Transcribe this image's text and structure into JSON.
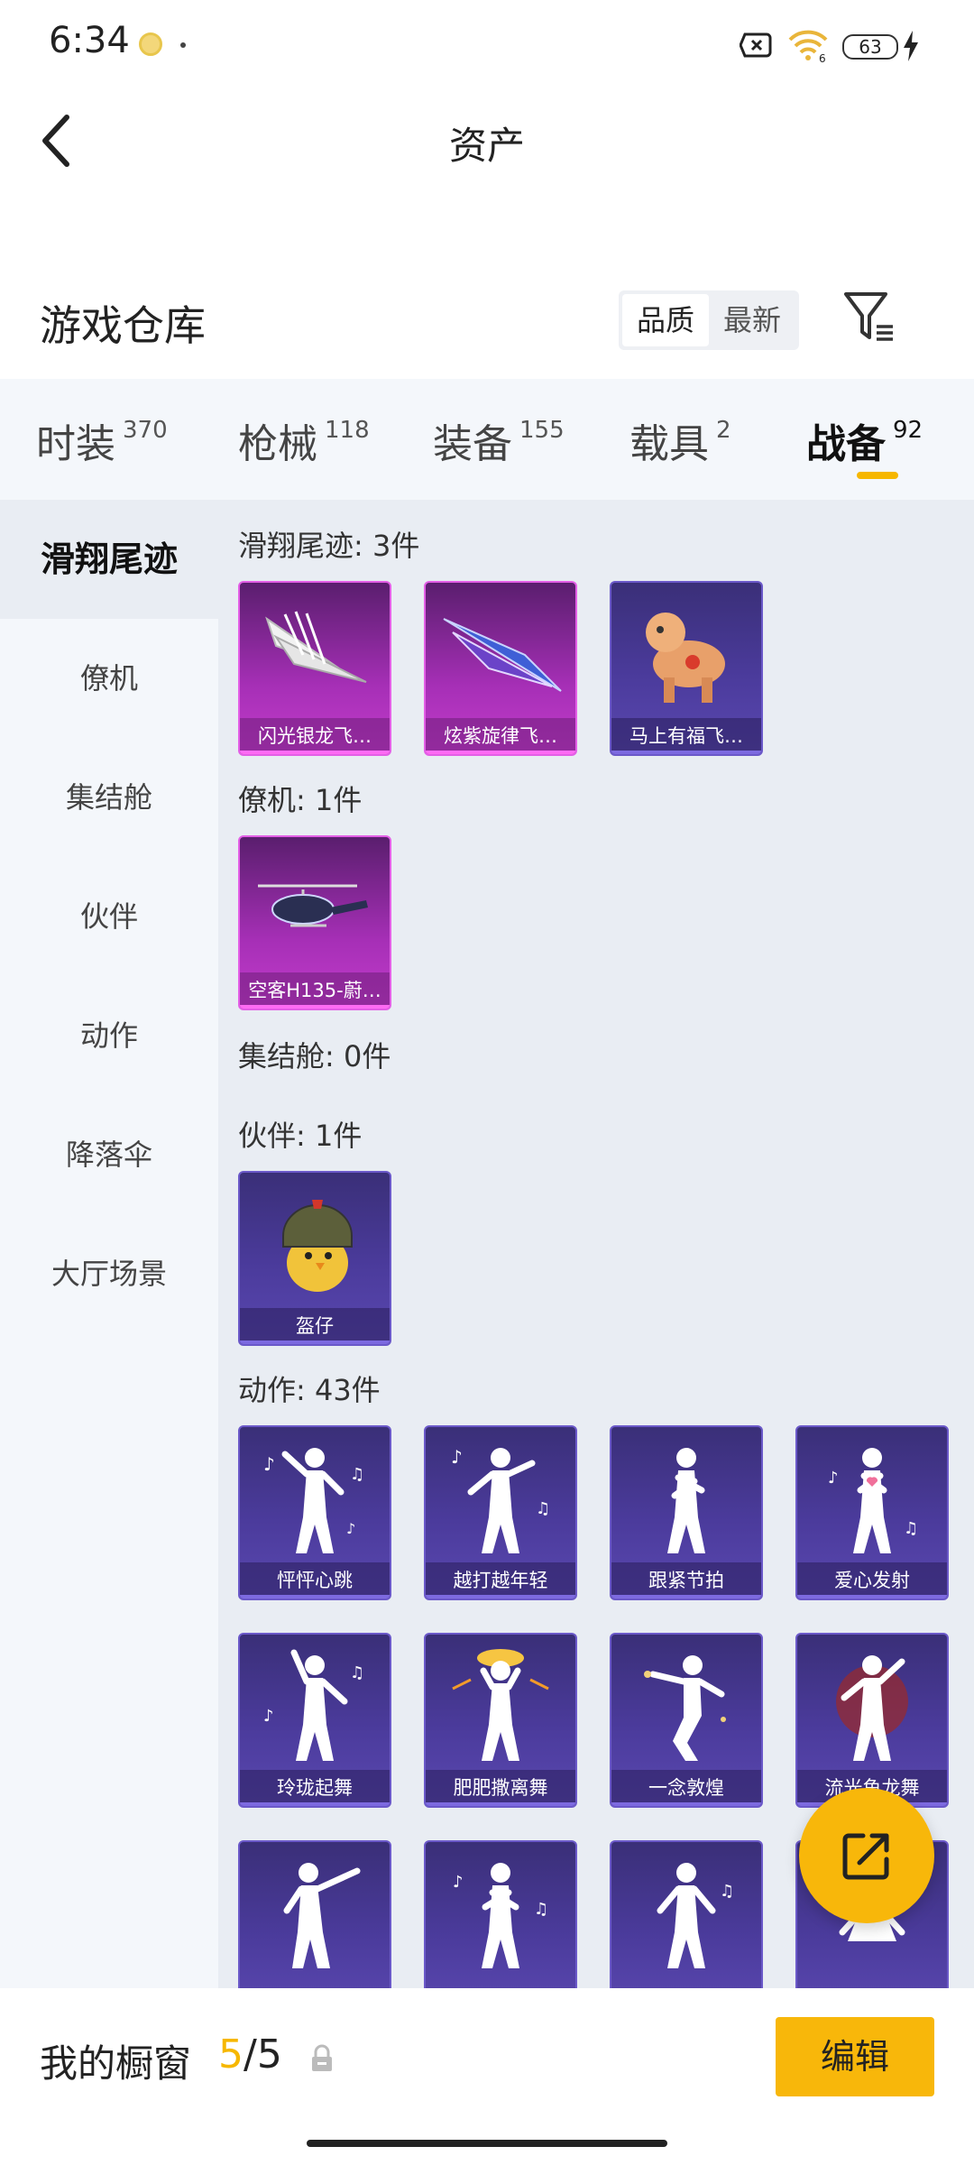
{
  "status_bar": {
    "time": "6:34",
    "battery": "63"
  },
  "header": {
    "title": "资产"
  },
  "section": {
    "title": "游戏仓库",
    "sort_quality": "品质",
    "sort_latest": "最新"
  },
  "tabs": [
    {
      "label": "时装",
      "count": "370"
    },
    {
      "label": "枪械",
      "count": "118"
    },
    {
      "label": "装备",
      "count": "155"
    },
    {
      "label": "载具",
      "count": "2"
    },
    {
      "label": "战备",
      "count": "92",
      "active": true
    }
  ],
  "sidebar": {
    "items": [
      {
        "label": "滑翔尾迹",
        "active": true
      },
      {
        "label": "僚机"
      },
      {
        "label": "集结舱"
      },
      {
        "label": "伙伴"
      },
      {
        "label": "动作"
      },
      {
        "label": "降落伞"
      },
      {
        "label": "大厅场景"
      }
    ]
  },
  "content": {
    "sections": [
      {
        "title": "滑翔尾迹: 3件",
        "items": [
          "闪光银龙飞…",
          "炫紫旋律飞…",
          "马上有福飞…"
        ]
      },
      {
        "title": "僚机: 1件",
        "items": [
          "空客H135-蔚…"
        ]
      },
      {
        "title": "集结舱: 0件",
        "items": []
      },
      {
        "title": "伙伴: 1件",
        "items": [
          "盔仔"
        ]
      },
      {
        "title": "动作: 43件",
        "items": [
          "怦怦心跳",
          "越打越年轻",
          "跟紧节拍",
          "爱心发射",
          "玲珑起舞",
          "肥肥撒离舞",
          "一念敦煌",
          "流光鱼龙舞"
        ]
      }
    ]
  },
  "bottom": {
    "showcase_label": "我的橱窗",
    "showcase_current": "5",
    "showcase_total": "/5",
    "edit_label": "编辑"
  },
  "colors": {
    "accent": "#f8b70a",
    "item_purple": "#4b3b9c",
    "item_magenta": "#a62fb6"
  }
}
